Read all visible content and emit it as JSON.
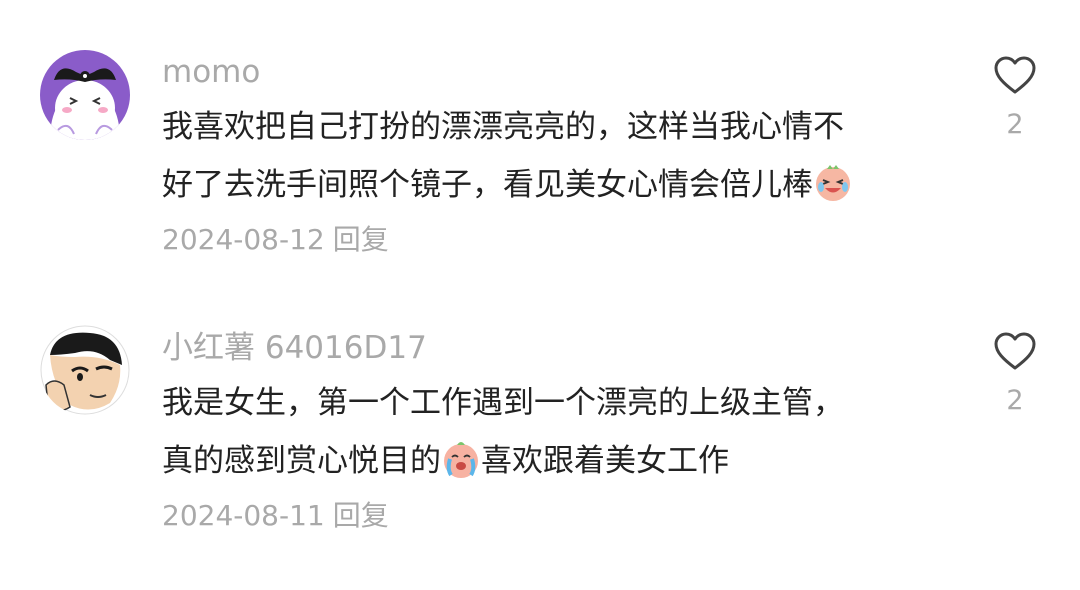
{
  "comments": [
    {
      "username": "momo",
      "avatar": "kuromi-avatar",
      "text_line1": "我喜欢把自己打扮的漂漂亮亮的，这样当我心情不",
      "text_line2": "好了去洗手间照个镜子，看见美女心情会倍儿棒",
      "emoji": "laughing-crying-face-emoji",
      "date": "2024-08-12",
      "reply_label": "回复",
      "likes": "2"
    },
    {
      "username": "小红薯 64016D17",
      "avatar": "cartoon-boy-avatar",
      "text_line1": "我是女生，第一个工作遇到一个漂亮的上级主管，",
      "text_line2_before": "真的感到赏心悦目的",
      "text_line2_after": "喜欢跟着美女工作",
      "emoji": "crying-peach-face-emoji",
      "date": "2024-08-11",
      "reply_label": "回复",
      "likes": "2"
    }
  ],
  "colors": {
    "text": "#222222",
    "secondary": "#a9a9a9",
    "background": "#ffffff"
  },
  "icons": {
    "like": "heart-outline-icon"
  }
}
